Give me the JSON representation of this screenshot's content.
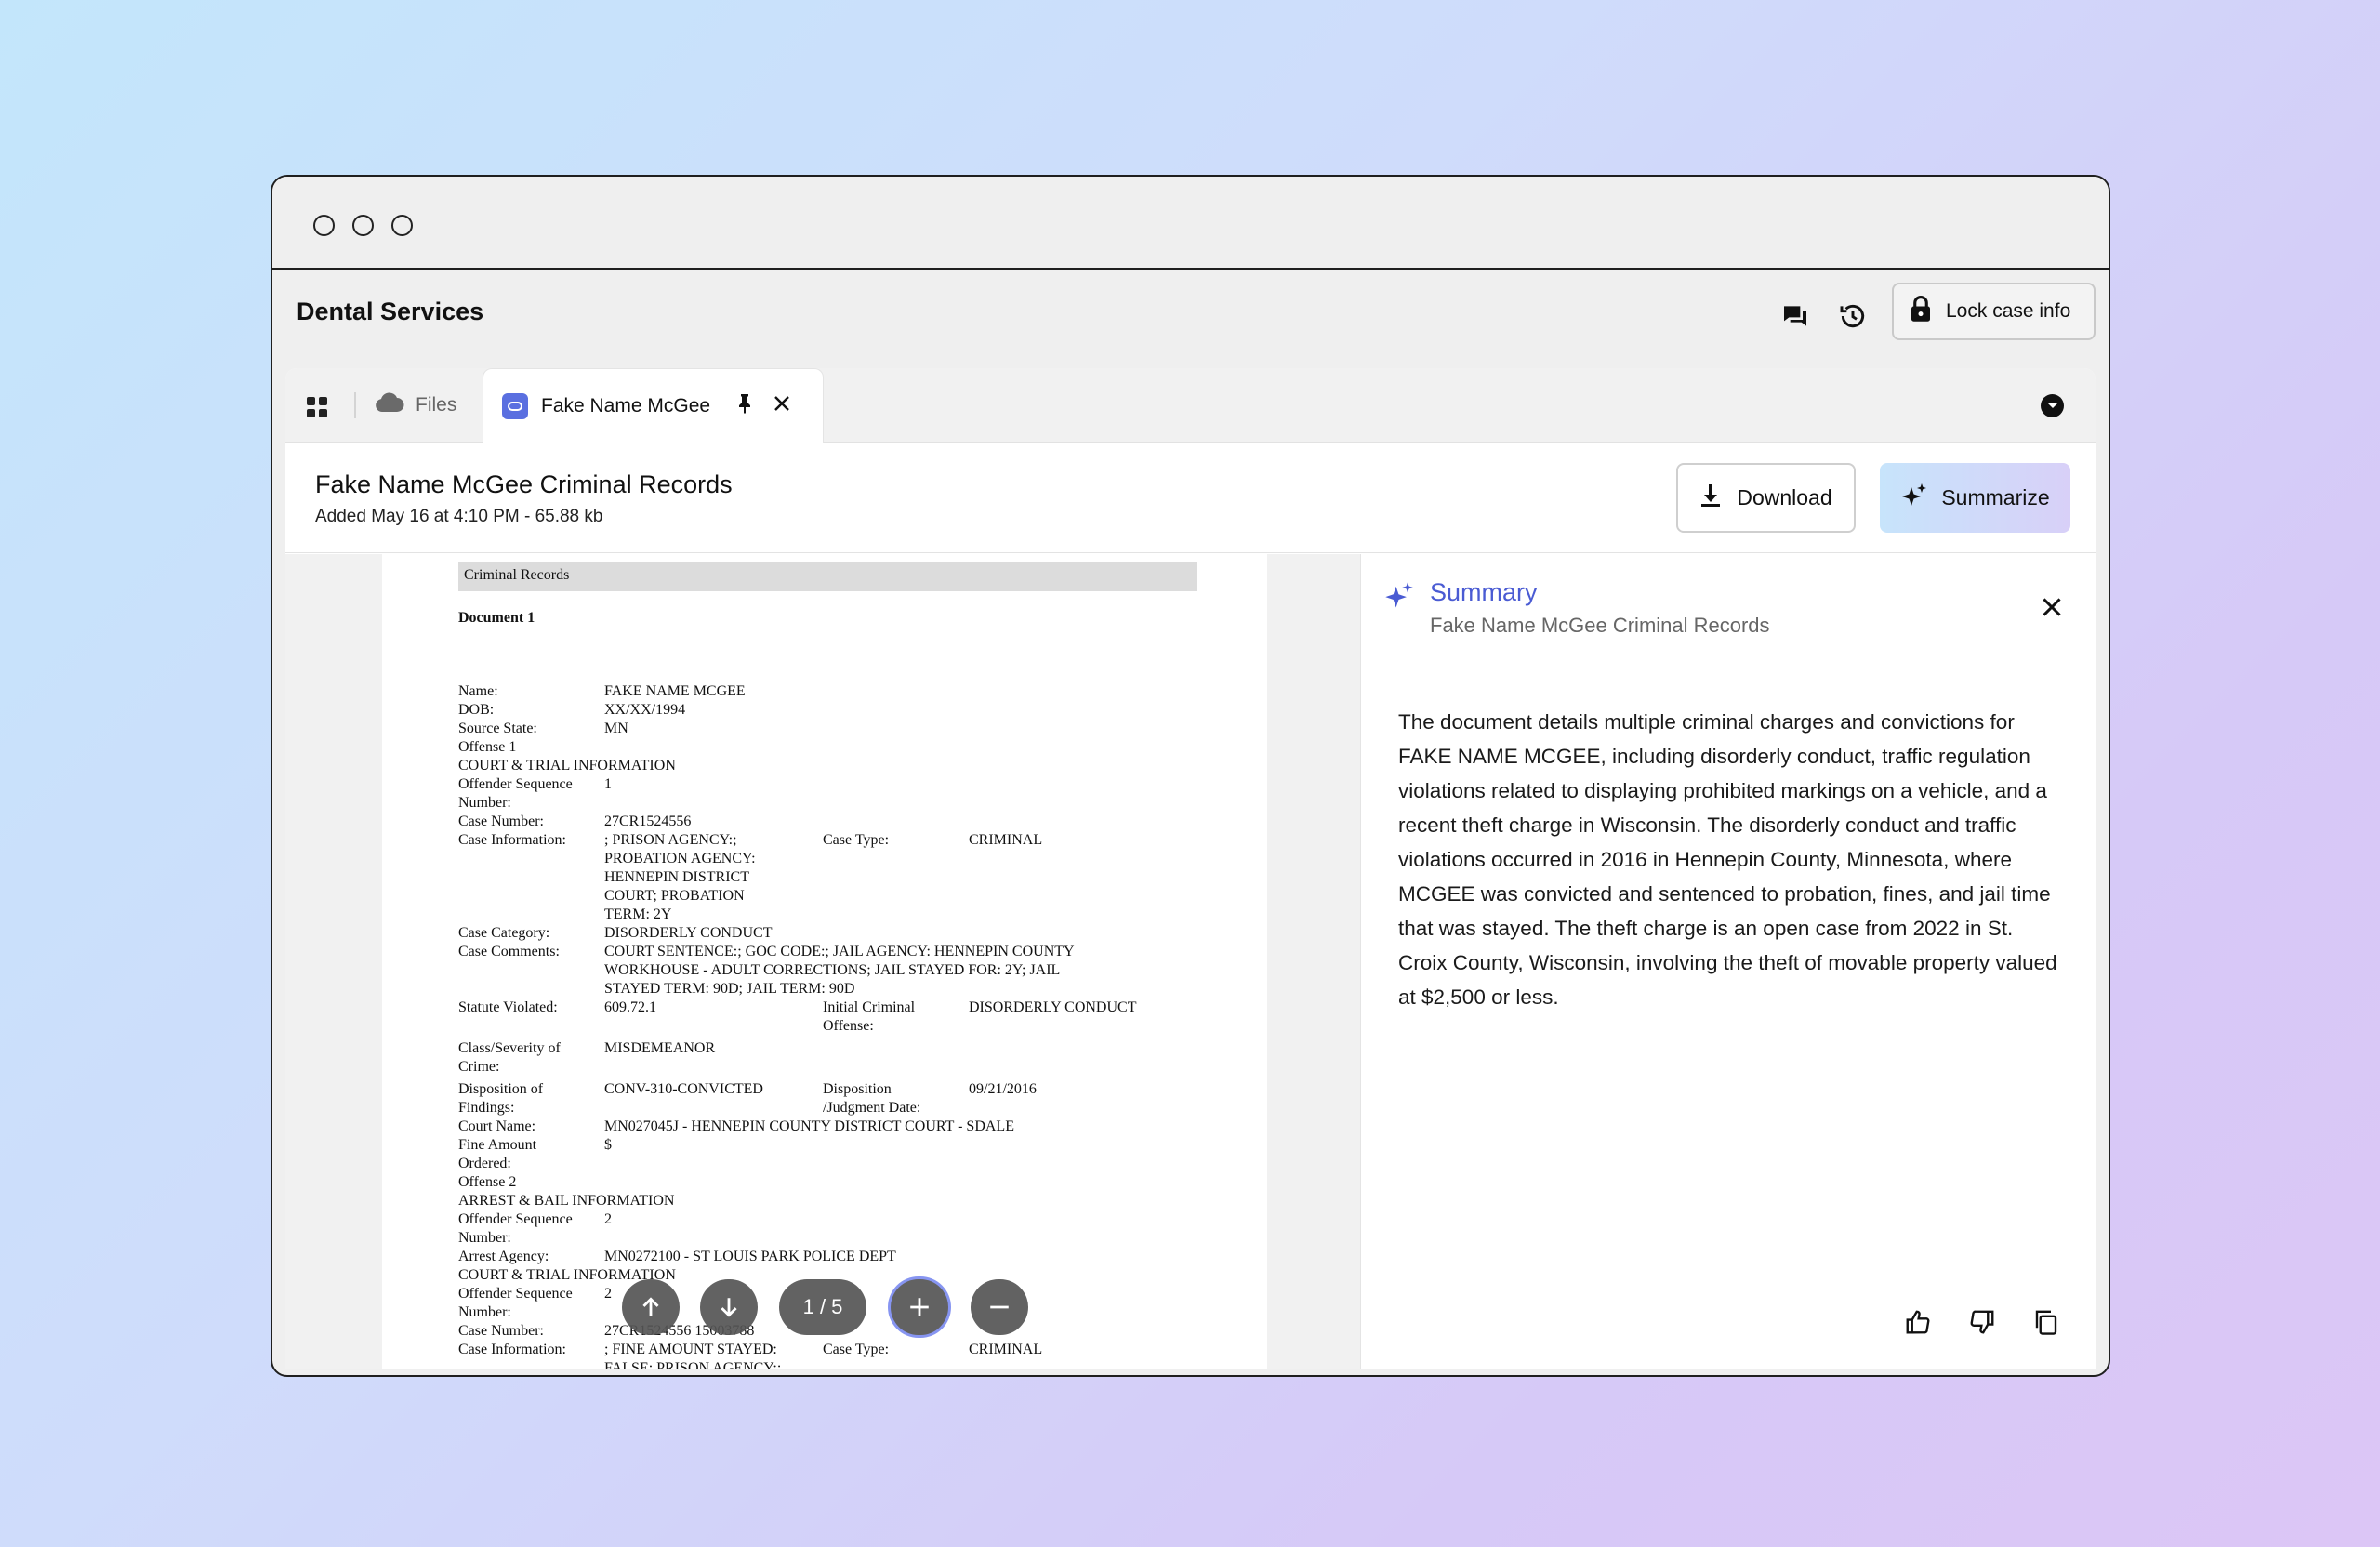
{
  "app": {
    "title": "Dental Services"
  },
  "header": {
    "lock_label": "Lock case info"
  },
  "tabs": {
    "files_label": "Files",
    "active_label": "Fake Name McGee"
  },
  "document": {
    "title": "Fake Name McGee Criminal Records",
    "meta": "Added May 16 at 4:10 PM - 65.88 kb",
    "download_label": "Download",
    "summarize_label": "Summarize"
  },
  "viewer": {
    "band_title": "Criminal Records",
    "doc_heading": "Document 1",
    "page_indicator": "1 / 5",
    "lines": [
      {
        "c1": "Name:",
        "c2": "FAKE NAME MCGEE"
      },
      {
        "c1": "DOB:",
        "c2": "XX/XX/1994"
      },
      {
        "c1": "Source State:",
        "c2": "MN"
      },
      {
        "c1": "Offense 1"
      },
      {
        "c1": "COURT & TRIAL INFORMATION"
      },
      {
        "c1": "Offender Sequence",
        "c2": "1"
      },
      {
        "c1": "Number:"
      },
      {
        "c1": "Case Number:",
        "c2": "27CR1524556"
      },
      {
        "c1": "Case Information:",
        "c2": "; PRISON AGENCY:;",
        "c3": "Case Type:",
        "c4": "CRIMINAL"
      },
      {
        "c2": "PROBATION AGENCY:"
      },
      {
        "c2": "HENNEPIN DISTRICT"
      },
      {
        "c2": "COURT; PROBATION"
      },
      {
        "c2": "TERM: 2Y"
      },
      {
        "c1": "Case Category:",
        "c2": "DISORDERLY CONDUCT"
      },
      {
        "c1": "Case Comments:",
        "c2": "COURT SENTENCE:; GOC CODE:; JAIL AGENCY: HENNEPIN COUNTY"
      },
      {
        "c2": "WORKHOUSE - ADULT CORRECTIONS; JAIL STAYED FOR: 2Y; JAIL"
      },
      {
        "c2": "STAYED TERM: 90D; JAIL TERM: 90D"
      },
      {
        "c1": "Statute Violated:",
        "c2": "609.72.1",
        "c3": "Initial Criminal",
        "c4": "DISORDERLY CONDUCT"
      },
      {
        "c3": "Offense:"
      },
      {
        "c1": "Class/Severity of",
        "c2": "MISDEMEANOR"
      },
      {
        "c1": "Crime:"
      },
      {
        "c1": "Disposition of",
        "c2": "CONV-310-CONVICTED",
        "c3": "Disposition",
        "c4": "09/21/2016"
      },
      {
        "c1": "Findings:",
        "c3": "/Judgment Date:"
      },
      {
        "c1": "Court Name:",
        "c2": "MN027045J - HENNEPIN COUNTY DISTRICT COURT - SDALE"
      },
      {
        "c1": "Fine Amount",
        "c2": "$"
      },
      {
        "c1": "Ordered:"
      },
      {
        "c1": "Offense 2"
      },
      {
        "c1": "ARREST & BAIL INFORMATION"
      },
      {
        "c1": "Offender Sequence",
        "c2": "2"
      },
      {
        "c1": "Number:"
      },
      {
        "c1": "Arrest Agency:",
        "c2": "MN0272100 - ST LOUIS PARK POLICE DEPT"
      },
      {
        "c1": "COURT & TRIAL INFORMATION"
      },
      {
        "c1": "Offender Sequence",
        "c2": "2"
      },
      {
        "c1": "Number:"
      },
      {
        "c1": "Case Number:",
        "c2": "27CR1524556 15003788"
      },
      {
        "c1": "Case Information:",
        "c2": "; FINE AMOUNT STAYED:",
        "c3": "Case Type:",
        "c4": "CRIMINAL"
      },
      {
        "c2": "FALSE; PRISON AGENCY:;"
      }
    ]
  },
  "summary": {
    "title": "Summary",
    "subtitle": "Fake Name McGee Criminal Records",
    "body": "The document details multiple criminal charges and convictions for FAKE NAME MCGEE, including disorderly conduct, traffic regulation violations related to displaying prohibited markings on a vehicle, and a recent theft charge in Wisconsin. The disorderly conduct and traffic violations occurred in 2016 in Hennepin County, Minnesota, where MCGEE was convicted and sentenced to probation, fines, and jail time that was stayed. The theft charge is an open case from 2022 in St. Croix County, Wisconsin, involving the theft of movable property valued at $2,500 or less."
  },
  "colors": {
    "accent": "#4a5bd3",
    "tab_icon": "#5a6fe0"
  },
  "icons": [
    "chat-icon",
    "history-icon",
    "lock-icon",
    "grid-icon",
    "cloud-icon",
    "document-icon",
    "pin-icon",
    "close-icon",
    "chevron-down-icon",
    "download-icon",
    "sparkle-icon",
    "arrow-up-icon",
    "arrow-down-icon",
    "plus-icon",
    "minus-icon",
    "thumbs-up-icon",
    "thumbs-down-icon",
    "copy-icon"
  ]
}
